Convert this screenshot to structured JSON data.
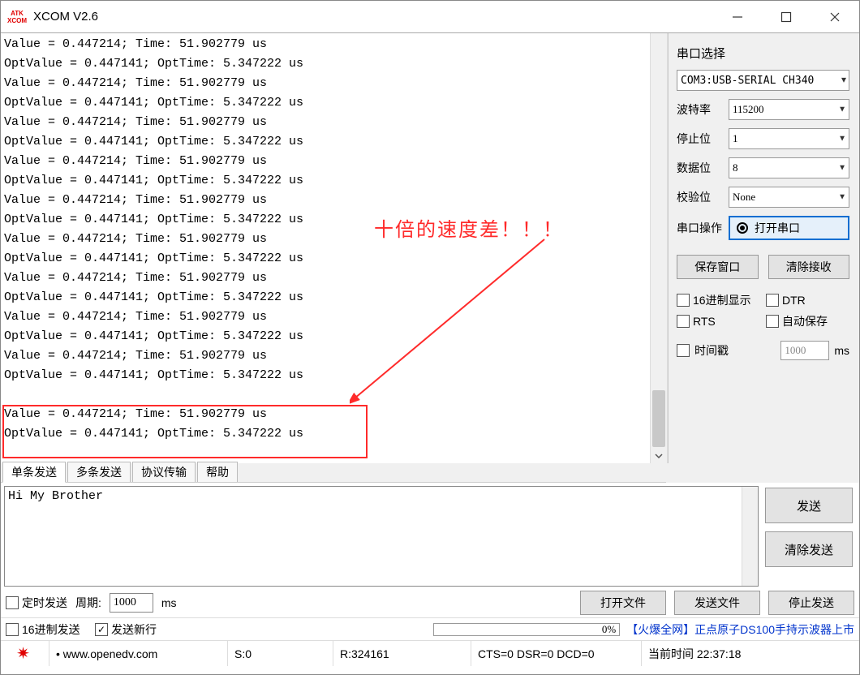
{
  "window": {
    "title": "XCOM V2.6",
    "icon_top": "ATK",
    "icon_bot": "XCOM"
  },
  "log_lines": [
    "Value = 0.447214; Time: 51.902779 us",
    "OptValue = 0.447141; OptTime: 5.347222 us",
    "Value = 0.447214; Time: 51.902779 us",
    "OptValue = 0.447141; OptTime: 5.347222 us",
    "Value = 0.447214; Time: 51.902779 us",
    "OptValue = 0.447141; OptTime: 5.347222 us",
    "Value = 0.447214; Time: 51.902779 us",
    "OptValue = 0.447141; OptTime: 5.347222 us",
    "Value = 0.447214; Time: 51.902779 us",
    "OptValue = 0.447141; OptTime: 5.347222 us",
    "Value = 0.447214; Time: 51.902779 us",
    "OptValue = 0.447141; OptTime: 5.347222 us",
    "Value = 0.447214; Time: 51.902779 us",
    "OptValue = 0.447141; OptTime: 5.347222 us",
    "Value = 0.447214; Time: 51.902779 us",
    "OptValue = 0.447141; OptTime: 5.347222 us",
    "Value = 0.447214; Time: 51.902779 us",
    "OptValue = 0.447141; OptTime: 5.347222 us",
    "",
    "Value = 0.447214; Time: 51.902779 us",
    "OptValue = 0.447141; OptTime: 5.347222 us"
  ],
  "annotation": {
    "text": "十倍的速度差！！！"
  },
  "side": {
    "section_title": "串口选择",
    "port_value": "COM3:USB-SERIAL CH340",
    "fields": {
      "baud": {
        "label": "波特率",
        "value": "115200"
      },
      "stop": {
        "label": "停止位",
        "value": "1"
      },
      "data": {
        "label": "数据位",
        "value": "8"
      },
      "parity": {
        "label": "校验位",
        "value": "None"
      }
    },
    "port_op_label": "串口操作",
    "port_op_button": "打开串口",
    "save_window": "保存窗口",
    "clear_recv": "清除接收",
    "chk_hex_disp": "16进制显示",
    "chk_dtr": "DTR",
    "chk_rts": "RTS",
    "chk_autosave": "自动保存",
    "chk_timestamp": "时间戳",
    "ts_value": "1000",
    "ts_unit": "ms"
  },
  "tabs": {
    "items": [
      "单条发送",
      "多条发送",
      "协议传输",
      "帮助"
    ],
    "active": 0
  },
  "send": {
    "text": "Hi My Brother",
    "send_btn": "发送",
    "clear_btn": "清除发送"
  },
  "options": {
    "timed_send": "定时发送",
    "period_label": "周期:",
    "period_value": "1000",
    "period_unit": "ms",
    "hex_send": "16进制发送",
    "send_newline": "发送新行",
    "open_file": "打开文件",
    "send_file": "发送文件",
    "stop_send": "停止发送"
  },
  "linkrow": {
    "progress_text": "0%",
    "ad_text": "【火爆全网】正点原子DS100手持示波器上市"
  },
  "statusbar": {
    "site": "www.openedv.com",
    "s": "S:0",
    "r": "R:324161",
    "cts": "CTS=0 DSR=0 DCD=0",
    "time_label": "当前时间 22:37:18"
  }
}
